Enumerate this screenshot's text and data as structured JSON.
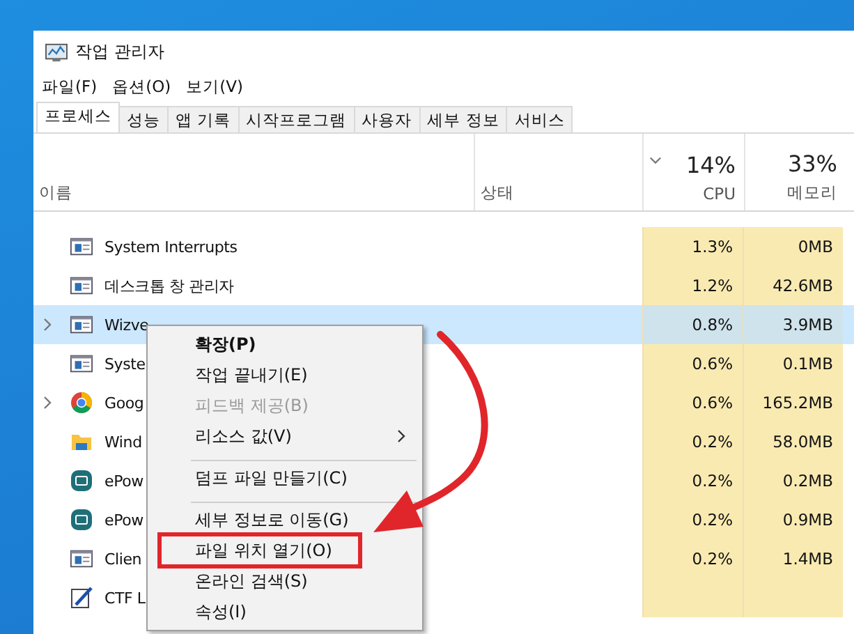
{
  "window": {
    "title": "작업 관리자"
  },
  "menu_bar": [
    "파일(F)",
    "옵션(O)",
    "보기(V)"
  ],
  "tabs": [
    {
      "label": "프로세스",
      "selected": true
    },
    {
      "label": "성능",
      "selected": false
    },
    {
      "label": "앱 기록",
      "selected": false
    },
    {
      "label": "시작프로그램",
      "selected": false
    },
    {
      "label": "사용자",
      "selected": false
    },
    {
      "label": "세부 정보",
      "selected": false
    },
    {
      "label": "서비스",
      "selected": false
    }
  ],
  "table": {
    "columns": [
      {
        "label": "이름"
      },
      {
        "label": "상태"
      },
      {
        "label": "CPU",
        "total": "14%",
        "sorted": true
      },
      {
        "label": "메모리",
        "total": "33%",
        "sorted": false
      }
    ],
    "rows": [
      {
        "name": "System Interrupts",
        "kind": "window",
        "expandable": false,
        "selected": false,
        "cpu": "1.3%",
        "memory": "0MB"
      },
      {
        "name": "데스크톱 창 관리자",
        "kind": "window",
        "expandable": false,
        "selected": false,
        "cpu": "1.2%",
        "memory": "42.6MB"
      },
      {
        "name": "Wizve",
        "kind": "window",
        "expandable": true,
        "selected": true,
        "cpu": "0.8%",
        "memory": "3.9MB"
      },
      {
        "name": "Syste",
        "kind": "window",
        "expandable": false,
        "selected": false,
        "cpu": "0.6%",
        "memory": "0.1MB"
      },
      {
        "name": "Goog",
        "kind": "browser",
        "expandable": true,
        "selected": false,
        "cpu": "0.6%",
        "memory": "165.2MB"
      },
      {
        "name": "Wind",
        "kind": "folder",
        "expandable": false,
        "selected": false,
        "cpu": "0.2%",
        "memory": "58.0MB"
      },
      {
        "name": "ePow",
        "kind": "app",
        "expandable": false,
        "selected": false,
        "cpu": "0.2%",
        "memory": "0.2MB"
      },
      {
        "name": "ePow",
        "kind": "app",
        "expandable": false,
        "selected": false,
        "cpu": "0.2%",
        "memory": "0.9MB"
      },
      {
        "name": "Clien",
        "kind": "window",
        "expandable": false,
        "selected": false,
        "cpu": "0.2%",
        "memory": "1.4MB"
      },
      {
        "name": "CTF L",
        "kind": "pen",
        "expandable": false,
        "selected": false
      }
    ]
  },
  "context_menu": {
    "items": [
      {
        "label": "확장(P)",
        "bold": true,
        "disabled": false,
        "submenu": false,
        "separator_after": false,
        "highlighted": false
      },
      {
        "label": "작업 끝내기(E)",
        "bold": false,
        "disabled": false,
        "submenu": false,
        "separator_after": false,
        "highlighted": false
      },
      {
        "label": "피드백 제공(B)",
        "bold": false,
        "disabled": true,
        "submenu": false,
        "separator_after": false,
        "highlighted": false
      },
      {
        "label": "리소스 값(V)",
        "bold": false,
        "disabled": false,
        "submenu": true,
        "separator_after": true,
        "highlighted": false
      },
      {
        "label": "덤프 파일 만들기(C)",
        "bold": false,
        "disabled": false,
        "submenu": false,
        "separator_after": true,
        "highlighted": false
      },
      {
        "label": "세부 정보로 이동(G)",
        "bold": false,
        "disabled": false,
        "submenu": false,
        "separator_after": false,
        "highlighted": false
      },
      {
        "label": "파일 위치 열기(O)",
        "bold": false,
        "disabled": false,
        "submenu": false,
        "separator_after": false,
        "highlighted": true
      },
      {
        "label": "온라인 검색(S)",
        "bold": false,
        "disabled": false,
        "submenu": false,
        "separator_after": false,
        "highlighted": false
      },
      {
        "label": "속성(I)",
        "bold": false,
        "disabled": false,
        "submenu": false,
        "separator_after": false,
        "highlighted": false
      }
    ]
  }
}
